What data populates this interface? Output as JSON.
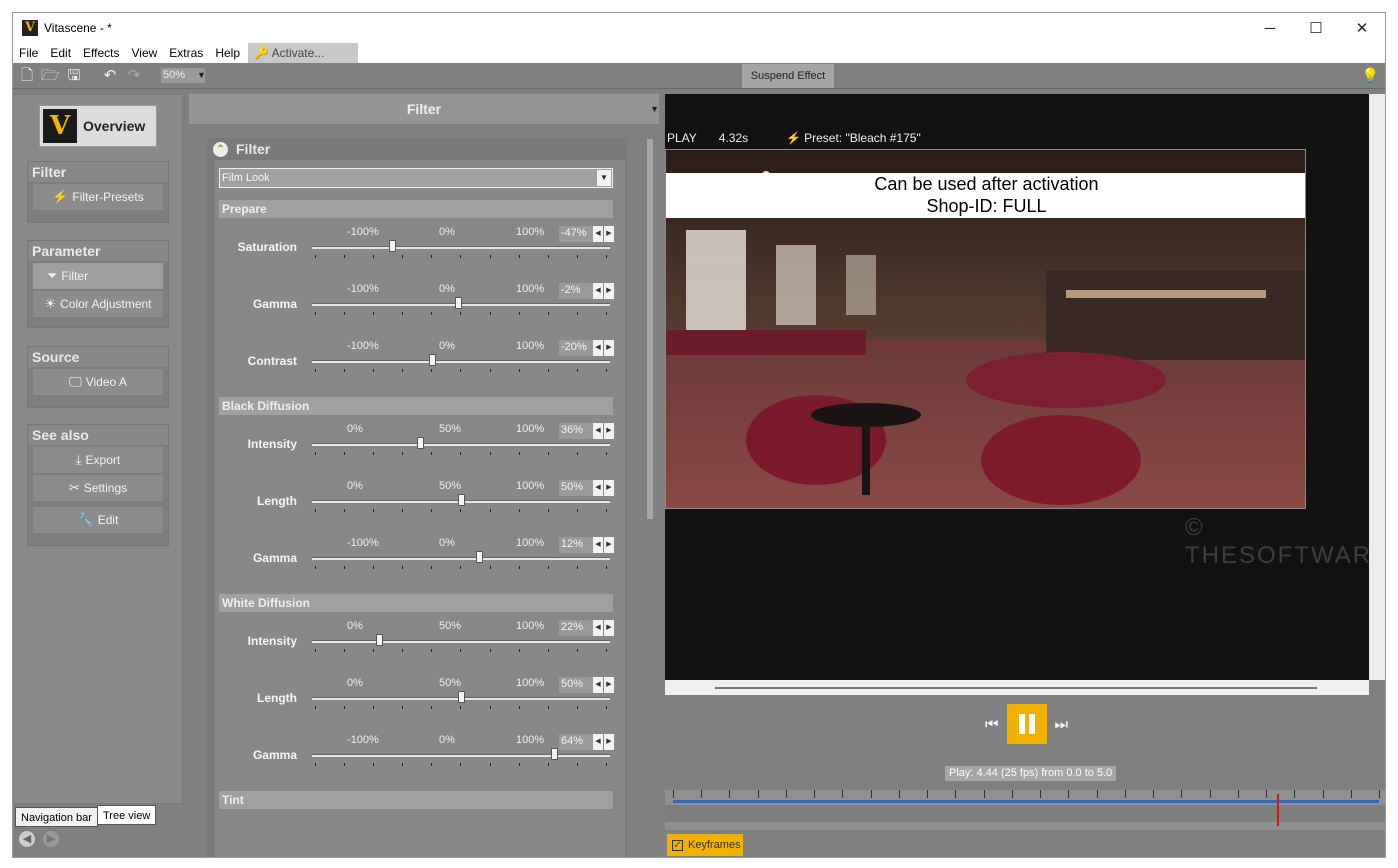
{
  "window": {
    "title": "Vitascene - *",
    "minimize": "─",
    "maximize": "☐",
    "close": "✕"
  },
  "menu": {
    "items": [
      "File",
      "Edit",
      "Effects",
      "View",
      "Extras",
      "Help"
    ],
    "activate": "Activate..."
  },
  "toolbar": {
    "zoom": "50%",
    "suspend": "Suspend Effect"
  },
  "nav": {
    "overview": "Overview",
    "groups": [
      {
        "title": "Filter",
        "items": [
          "Filter-Presets"
        ]
      },
      {
        "title": "Parameter",
        "items": [
          "Filter",
          "Color Adjustment"
        ]
      },
      {
        "title": "Source",
        "items": [
          "Video A"
        ]
      },
      {
        "title": "See also",
        "items": [
          "Export",
          "Settings",
          "Edit"
        ]
      }
    ],
    "tabs": [
      "Navigation bar",
      "Tree view"
    ]
  },
  "filter": {
    "header": "Filter",
    "box_title": "Filter",
    "preset": "Film Look",
    "sections": [
      {
        "title": "Prepare",
        "params": [
          {
            "label": "Saturation",
            "ticks": [
              "-100%",
              "0%",
              "100%"
            ],
            "value": "-47%",
            "pos": -47,
            "min": -100,
            "max": 100
          },
          {
            "label": "Gamma",
            "ticks": [
              "-100%",
              "0%",
              "100%"
            ],
            "value": "-2%",
            "pos": -2,
            "min": -100,
            "max": 100
          },
          {
            "label": "Contrast",
            "ticks": [
              "-100%",
              "0%",
              "100%"
            ],
            "value": "-20%",
            "pos": -20,
            "min": -100,
            "max": 100
          }
        ]
      },
      {
        "title": "Black Diffusion",
        "params": [
          {
            "label": "Intensity",
            "ticks": [
              "0%",
              "50%",
              "100%"
            ],
            "value": "36%",
            "pos": 36,
            "min": 0,
            "max": 100
          },
          {
            "label": "Length",
            "ticks": [
              "0%",
              "50%",
              "100%"
            ],
            "value": "50%",
            "pos": 50,
            "min": 0,
            "max": 100
          },
          {
            "label": "Gamma",
            "ticks": [
              "-100%",
              "0%",
              "100%"
            ],
            "value": "12%",
            "pos": 12,
            "min": -100,
            "max": 100
          }
        ]
      },
      {
        "title": "White Diffusion",
        "params": [
          {
            "label": "Intensity",
            "ticks": [
              "0%",
              "50%",
              "100%"
            ],
            "value": "22%",
            "pos": 22,
            "min": 0,
            "max": 100
          },
          {
            "label": "Length",
            "ticks": [
              "0%",
              "50%",
              "100%"
            ],
            "value": "50%",
            "pos": 50,
            "min": 0,
            "max": 100
          },
          {
            "label": "Gamma",
            "ticks": [
              "-100%",
              "0%",
              "100%"
            ],
            "value": "64%",
            "pos": 64,
            "min": -100,
            "max": 100
          }
        ]
      },
      {
        "title": "Tint",
        "params": []
      }
    ]
  },
  "preview": {
    "state": "PLAY",
    "time": "4.32s",
    "preset": "Preset: \"Bleach #175\"",
    "notice_line1": "Can be used after activation",
    "notice_line2": "Shop-ID:  FULL",
    "watermark": "© THESOFTWARESHOP",
    "status": "Play: 4.44 (25 fps) from 0.0 to 5.0",
    "keyframes": "Keyframes",
    "keyframes_checked": true,
    "playhead_fraction": 0.888
  },
  "colors": {
    "accent": "#f2b100",
    "timeline": "#3a68b0",
    "playhead": "#c81818"
  }
}
